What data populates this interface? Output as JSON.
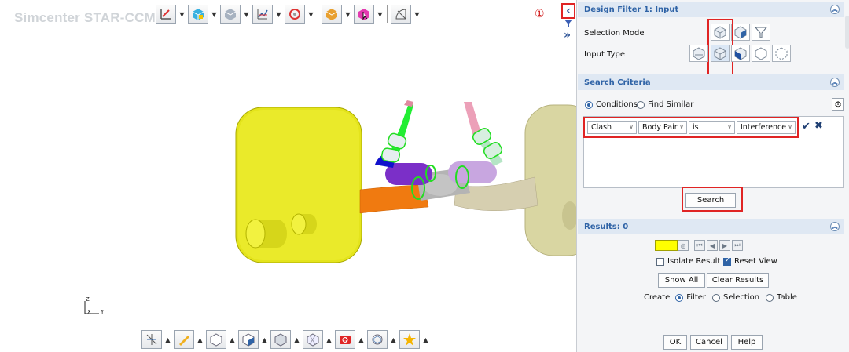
{
  "app": {
    "title": "Simcenter STAR-CCM+"
  },
  "viewport": {
    "marker": "①",
    "axes": {
      "z": "Z",
      "x": "X",
      "y": "Y"
    },
    "top_toolbar_icons": [
      "scene-icon",
      "part-icon",
      "region-icon",
      "plot-icon",
      "vector-icon",
      "display-icon",
      "select-icon",
      "angle-icon"
    ],
    "bottom_toolbar_icons": [
      "plane-icon",
      "pencil-icon",
      "cube-wire-icon",
      "cube-cut-icon",
      "cube-outline-icon",
      "cube-mesh-icon",
      "repair-icon",
      "rotate-icon",
      "favorite-icon"
    ]
  },
  "panel": {
    "design_filter": {
      "title": "Design Filter 1: Input",
      "selection_mode_label": "Selection Mode",
      "input_type_label": "Input Type"
    },
    "search_criteria": {
      "title": "Search Criteria",
      "conditions_label": "Conditions",
      "find_similar_label": "Find Similar",
      "selected_mode": "Conditions",
      "criteria": [
        {
          "field": "Clash",
          "operand": "Body Pair",
          "operator": "is",
          "value": "Interference"
        }
      ],
      "search_button": "Search"
    },
    "results": {
      "title": "Results: 0",
      "isolate_result_label": "Isolate Result",
      "isolate_result_checked": false,
      "reset_view_label": "Reset View",
      "reset_view_checked": true,
      "show_all_label": "Show All",
      "clear_results_label": "Clear Results",
      "create_label": "Create",
      "create_options": [
        "Filter",
        "Selection",
        "Table"
      ],
      "create_selected": "Filter",
      "swatch_color": "#ffff00"
    },
    "footer": {
      "ok": "OK",
      "cancel": "Cancel",
      "help": "Help"
    }
  },
  "colors": {
    "accent": "#2f63a6",
    "highlight_red": "#e02424",
    "section_header": "#dfe8f3"
  }
}
